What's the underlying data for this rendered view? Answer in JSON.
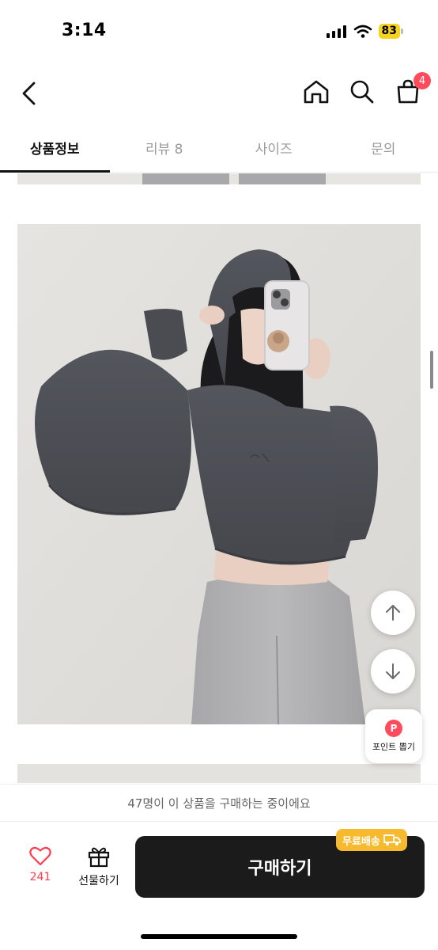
{
  "status_bar": {
    "time": "3:14",
    "battery": "83",
    "colors": {
      "battery": "#f5d31e"
    }
  },
  "nav": {
    "back_icon": "chevron-left-icon",
    "home_icon": "home-icon",
    "search_icon": "search-icon",
    "cart_icon": "shopping-bag-icon",
    "cart_badge": "4",
    "colors": {
      "badge": "#ff4b5c"
    }
  },
  "tabs": [
    {
      "label": "상품정보",
      "active": true
    },
    {
      "label": "리뷰 8",
      "active": false
    },
    {
      "label": "사이즈",
      "active": false
    },
    {
      "label": "문의",
      "active": false
    }
  ],
  "floating": {
    "scroll_up_icon": "arrow-up-icon",
    "scroll_down_icon": "arrow-down-icon",
    "point_icon_letter": "P",
    "point_label": "포인트 뽑기"
  },
  "buying_notice": "47명이 이 상품을 구매하는 중이에요",
  "actions": {
    "like_icon": "heart-icon",
    "like_count": "241",
    "gift_icon": "gift-icon",
    "gift_label": "선물하기",
    "buy_label": "구매하기",
    "free_shipping_label": "무료배송",
    "free_shipping_icon": "truck-icon",
    "colors": {
      "buy_bg": "#1b1b1b",
      "free_ship": "#f7b92d",
      "like": "#ff3c4f"
    }
  }
}
